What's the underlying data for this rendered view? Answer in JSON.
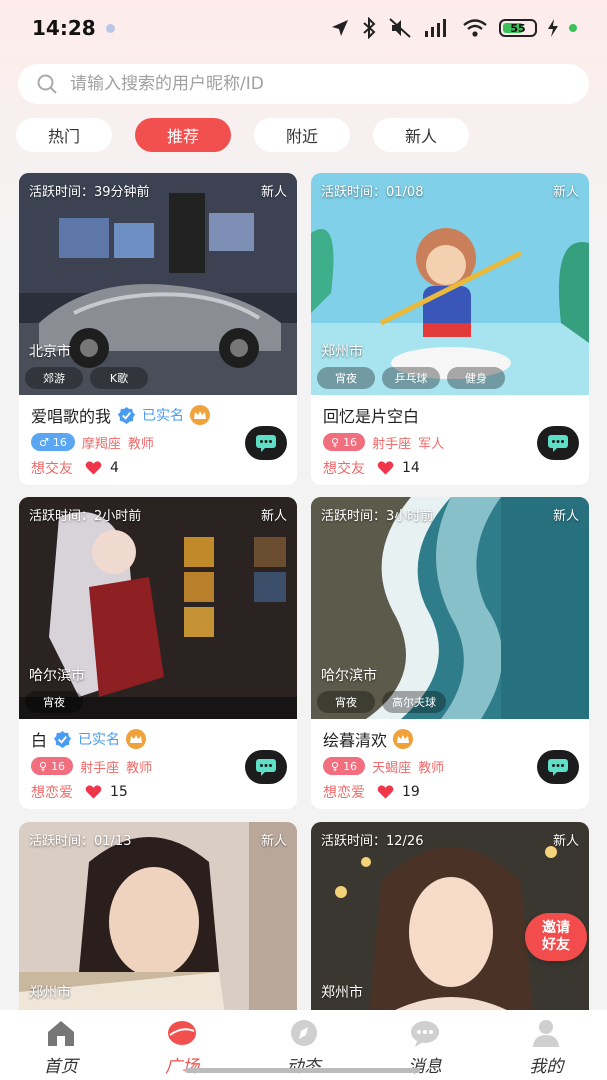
{
  "status_bar": {
    "time": "14:28",
    "battery": "55"
  },
  "search": {
    "placeholder": "请输入搜索的用户昵称/ID"
  },
  "tabs": [
    {
      "label": "热门",
      "active": false
    },
    {
      "label": "推荐",
      "active": true
    },
    {
      "label": "附近",
      "active": false
    },
    {
      "label": "新人",
      "active": false
    }
  ],
  "cards": [
    {
      "active_time": "活跃时间：39分钟前",
      "new_tag": "新人",
      "city": "北京市",
      "tags": [
        "郊游",
        "K歌"
      ],
      "name": "爱唱歌的我",
      "verified": "已实名",
      "gender": "♂",
      "age": "16",
      "zodiac": "摩羯座",
      "job": "教师",
      "intent": "想交友",
      "likes": "4"
    },
    {
      "active_time": "活跃时间：01/08",
      "new_tag": "新人",
      "city": "郑州市",
      "tags": [
        "宵夜",
        "乒乓球",
        "健身"
      ],
      "name": "回忆是片空白",
      "gender": "♀",
      "age": "16",
      "zodiac": "射手座",
      "job": "军人",
      "intent": "想交友",
      "likes": "14"
    },
    {
      "active_time": "活跃时间：2小时前",
      "new_tag": "新人",
      "city": "哈尔滨市",
      "tags": [
        "宵夜"
      ],
      "name": "白",
      "verified": "已实名",
      "gender": "♀",
      "age": "16",
      "zodiac": "射手座",
      "job": "教师",
      "intent": "想恋爱",
      "likes": "15"
    },
    {
      "active_time": "活跃时间：3小时前",
      "new_tag": "新人",
      "city": "哈尔滨市",
      "tags": [
        "宵夜",
        "高尔夫球"
      ],
      "name": "绘暮清欢",
      "gender": "♀",
      "age": "16",
      "zodiac": "天蝎座",
      "job": "教师",
      "intent": "想恋爱",
      "likes": "19"
    },
    {
      "active_time": "活跃时间：01/13",
      "new_tag": "新人",
      "city": "郑州市"
    },
    {
      "active_time": "活跃时间：12/26",
      "new_tag": "新人",
      "city": "郑州市"
    }
  ],
  "invite": {
    "line1": "邀请",
    "line2": "好友"
  },
  "nav": [
    {
      "label": "首页",
      "icon": "home-icon"
    },
    {
      "label": "广场",
      "icon": "plaza-icon",
      "active": true
    },
    {
      "label": "动态",
      "icon": "compass-icon"
    },
    {
      "label": "消息",
      "icon": "message-icon"
    },
    {
      "label": "我的",
      "icon": "profile-icon"
    }
  ],
  "colors": {
    "accent": "#f24f4f",
    "verified": "#4a9cf2",
    "male": "#5aa6f2",
    "female": "#f06e7e",
    "crown": "#f0a23a"
  }
}
